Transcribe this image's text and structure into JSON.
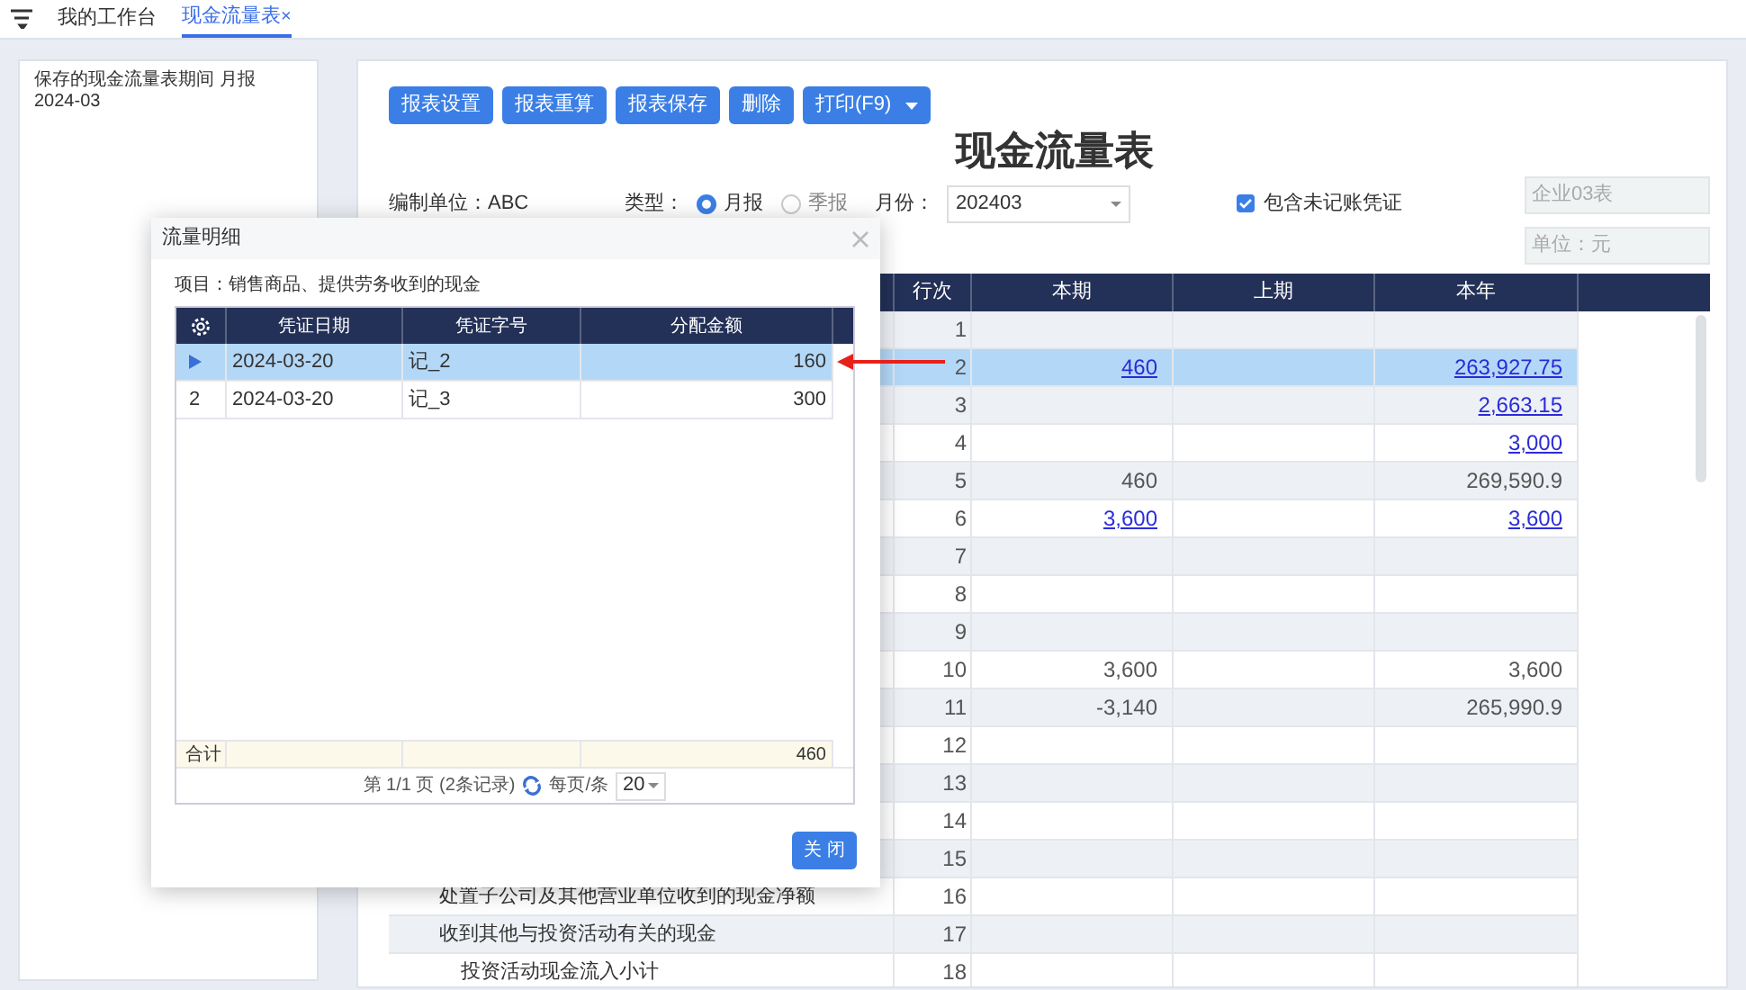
{
  "tabs": [
    {
      "label": "我的工作台",
      "selected": false
    },
    {
      "label": "现金流量表",
      "selected": true,
      "close": "×"
    }
  ],
  "saved_periods": [
    "保存的现金流量表期间 月报 2024-03"
  ],
  "toolbar": [
    {
      "label": "报表设置",
      "dropdown": false
    },
    {
      "label": "报表重算",
      "dropdown": false
    },
    {
      "label": "报表保存",
      "dropdown": false
    },
    {
      "label": "删除",
      "dropdown": false
    },
    {
      "label": "打印(F9)",
      "dropdown": true
    }
  ],
  "report_title": "现金流量表",
  "filters": {
    "company": "编制单位：ABC",
    "type_label": "类型：",
    "types": [
      {
        "label": "月报",
        "selected": true
      },
      {
        "label": "季报",
        "selected": false
      }
    ],
    "month_label": "月份：",
    "month": "202403",
    "include_unposted": {
      "label": "包含未记账凭证",
      "checked": true
    },
    "template": "企业03表",
    "unit": "单位：元"
  },
  "table": {
    "columns": [
      "行次",
      "本期",
      "上期",
      "本年"
    ],
    "rows": [
      {
        "line": "1",
        "selected": false
      },
      {
        "line": "2",
        "selected": true,
        "current": {
          "text": "460",
          "link": true
        },
        "year": {
          "text": "263,927.75",
          "link": true
        }
      },
      {
        "line": "3",
        "selected": false,
        "year": {
          "text": "2,663.15",
          "link": true
        }
      },
      {
        "line": "4",
        "selected": false,
        "year": {
          "text": "3,000",
          "link": true
        }
      },
      {
        "line": "5",
        "selected": false,
        "current": {
          "text": "460",
          "link": false
        },
        "year": {
          "text": "269,590.9",
          "link": false
        }
      },
      {
        "line": "6",
        "selected": false,
        "current": {
          "text": "3,600",
          "link": true
        },
        "year": {
          "text": "3,600",
          "link": true
        }
      },
      {
        "line": "7",
        "selected": false
      },
      {
        "line": "8",
        "selected": false
      },
      {
        "line": "9",
        "selected": false
      },
      {
        "line": "10",
        "selected": false,
        "current": {
          "text": "3,600",
          "link": false
        },
        "year": {
          "text": "3,600",
          "link": false
        }
      },
      {
        "line": "11",
        "selected": false,
        "current": {
          "text": "-3,140",
          "link": false
        },
        "year": {
          "text": "265,990.9",
          "link": false
        }
      },
      {
        "line": "12",
        "selected": false
      },
      {
        "line": "13",
        "selected": false
      },
      {
        "line": "14",
        "selected": false
      },
      {
        "line": "15",
        "selected": false
      },
      {
        "line": "16",
        "kind": "item",
        "selected": false,
        "name": "处置子公司及其他营业单位收到的现金净额"
      },
      {
        "line": "17",
        "kind": "item",
        "selected": false,
        "name": "收到其他与投资活动有关的现金"
      },
      {
        "line": "18",
        "kind": "subtotal",
        "selected": false,
        "name": "投资活动现金流入小计"
      }
    ]
  },
  "dialog": {
    "title": "流量明细",
    "item": "项目：销售商品、提供劳务收到的现金",
    "columns": [
      "凭证日期",
      "凭证字号",
      "分配金额"
    ],
    "rows": [
      {
        "selected": true,
        "date": "2024-03-20",
        "voucher": "记_2",
        "amount": "160"
      },
      {
        "index": "2",
        "selected": false,
        "date": "2024-03-20",
        "voucher": "记_3",
        "amount": "300"
      }
    ],
    "total_label": "合计",
    "total": "460",
    "pager": {
      "page": "第 1/1 页 (2条记录)",
      "per_page_label": "每页/条",
      "per_page": "20"
    },
    "close_button": "关 闭"
  }
}
